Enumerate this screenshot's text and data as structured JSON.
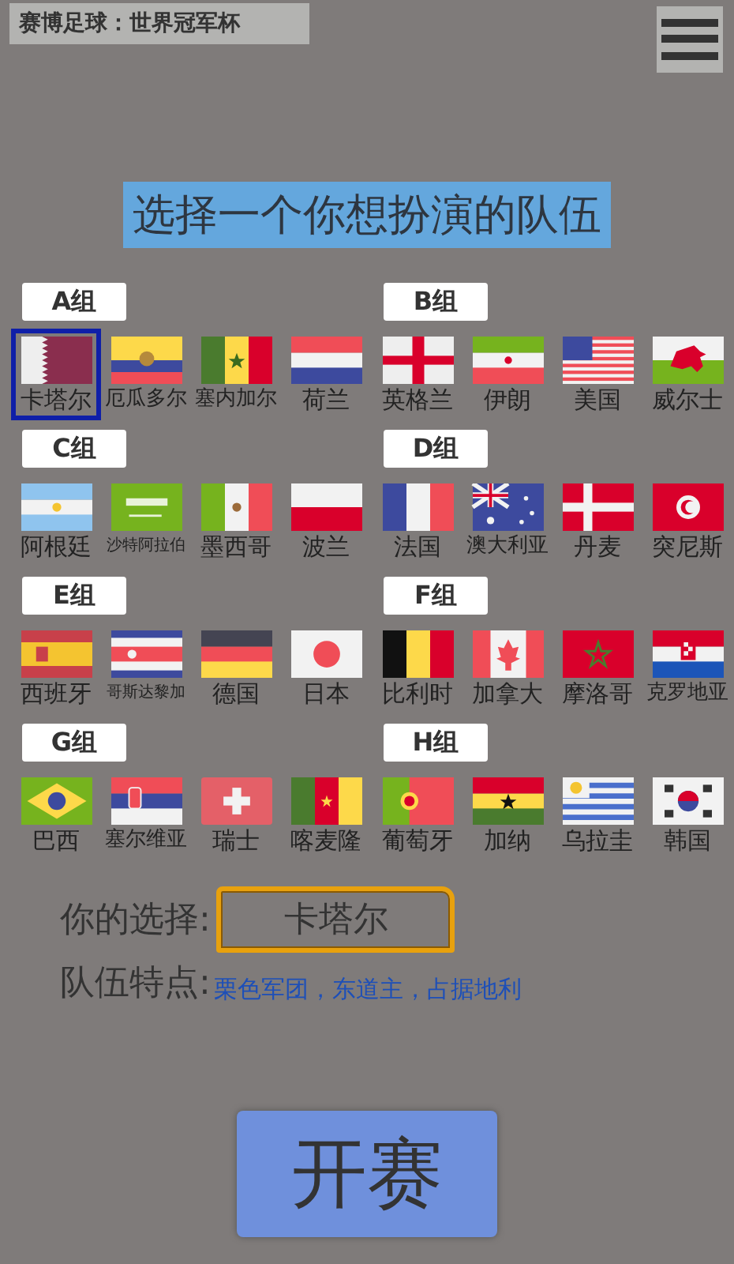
{
  "title_bar": {
    "title": "赛博足球：世界冠军杯"
  },
  "heading": "选择一个你想扮演的队伍",
  "groups": [
    {
      "label": "A组",
      "teams": [
        {
          "name": "卡塔尔",
          "kind": "qa",
          "selected": true
        },
        {
          "name": "厄瓜多尔",
          "kind": "ec",
          "selected": false
        },
        {
          "name": "塞内加尔",
          "kind": "sn",
          "selected": false
        },
        {
          "name": "荷兰",
          "kind": "nl",
          "selected": false
        }
      ]
    },
    {
      "label": "B组",
      "teams": [
        {
          "name": "英格兰",
          "kind": "en",
          "selected": false
        },
        {
          "name": "伊朗",
          "kind": "ir",
          "selected": false
        },
        {
          "name": "美国",
          "kind": "us",
          "selected": false
        },
        {
          "name": "威尔士",
          "kind": "wa",
          "selected": false
        }
      ]
    },
    {
      "label": "C组",
      "teams": [
        {
          "name": "阿根廷",
          "kind": "ar",
          "selected": false
        },
        {
          "name": "沙特阿拉伯",
          "kind": "sa",
          "selected": false
        },
        {
          "name": "墨西哥",
          "kind": "mx",
          "selected": false
        },
        {
          "name": "波兰",
          "kind": "pl",
          "selected": false
        }
      ]
    },
    {
      "label": "D组",
      "teams": [
        {
          "name": "法国",
          "kind": "fr",
          "selected": false
        },
        {
          "name": "澳大利亚",
          "kind": "au",
          "selected": false
        },
        {
          "name": "丹麦",
          "kind": "dk",
          "selected": false
        },
        {
          "name": "突尼斯",
          "kind": "tn",
          "selected": false
        }
      ]
    },
    {
      "label": "E组",
      "teams": [
        {
          "name": "西班牙",
          "kind": "es",
          "selected": false
        },
        {
          "name": "哥斯达黎加",
          "kind": "cr",
          "selected": false
        },
        {
          "name": "德国",
          "kind": "de",
          "selected": false
        },
        {
          "name": "日本",
          "kind": "jp",
          "selected": false
        }
      ]
    },
    {
      "label": "F组",
      "teams": [
        {
          "name": "比利时",
          "kind": "be",
          "selected": false
        },
        {
          "name": "加拿大",
          "kind": "ca",
          "selected": false
        },
        {
          "name": "摩洛哥",
          "kind": "ma",
          "selected": false
        },
        {
          "name": "克罗地亚",
          "kind": "hr",
          "selected": false
        }
      ]
    },
    {
      "label": "G组",
      "teams": [
        {
          "name": "巴西",
          "kind": "br",
          "selected": false
        },
        {
          "name": "塞尔维亚",
          "kind": "rs",
          "selected": false
        },
        {
          "name": "瑞士",
          "kind": "ch",
          "selected": false
        },
        {
          "name": "喀麦隆",
          "kind": "cm",
          "selected": false
        }
      ]
    },
    {
      "label": "H组",
      "teams": [
        {
          "name": "葡萄牙",
          "kind": "pt",
          "selected": false
        },
        {
          "name": "加纳",
          "kind": "gh",
          "selected": false
        },
        {
          "name": "乌拉圭",
          "kind": "uy",
          "selected": false
        },
        {
          "name": "韩国",
          "kind": "kr",
          "selected": false
        }
      ]
    }
  ],
  "choice": {
    "label": "你的选择:",
    "value": "卡塔尔"
  },
  "traits": {
    "label": "队伍特点:",
    "value": "栗色军团，东道主，占据地利"
  },
  "start_button": "开赛"
}
